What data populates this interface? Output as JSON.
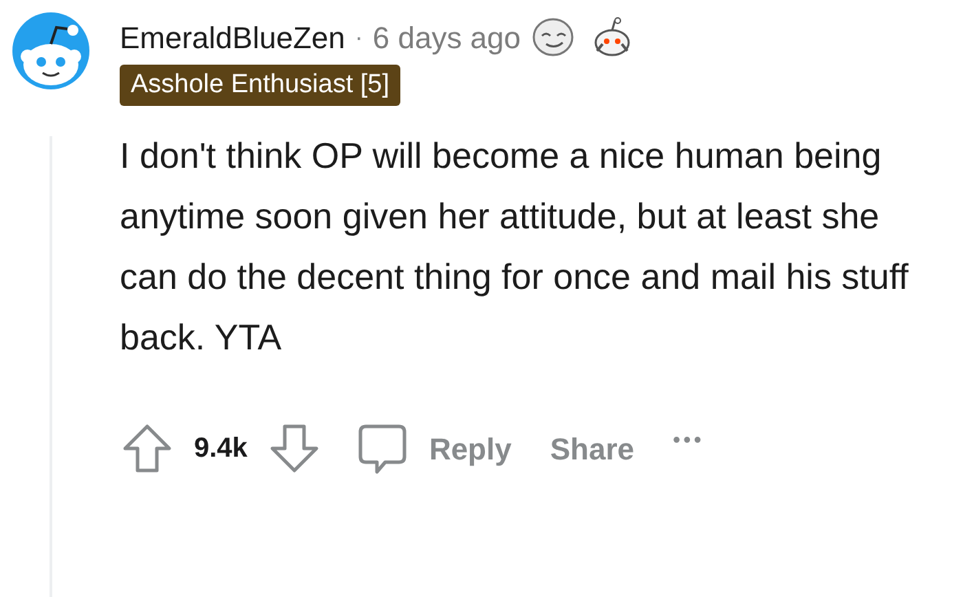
{
  "comment": {
    "author": "EmeraldBlueZen",
    "separator": "·",
    "time": "6 days ago",
    "flair": "Asshole Enthusiast [5]",
    "body": "I don't think OP will become a nice human being anytime soon given her attitude, but at least she can do the decent thing for once and mail his stuff back. YTA",
    "score": "9.4k",
    "actions": [
      "Reply",
      "Share"
    ],
    "more": "•••"
  }
}
